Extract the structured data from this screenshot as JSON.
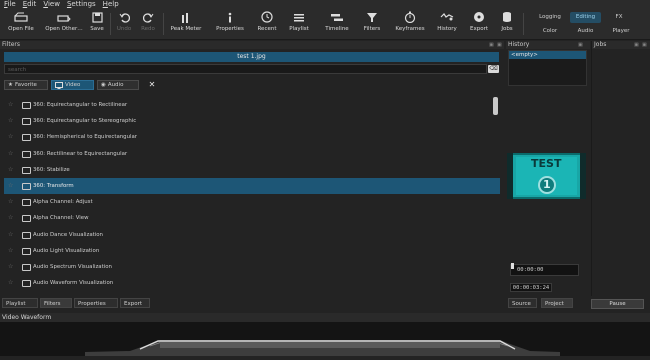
{
  "menu": [
    "File",
    "Edit",
    "View",
    "Settings",
    "Help"
  ],
  "toolbar": {
    "buttons": [
      {
        "label": "Open File",
        "icon": "open-file-icon"
      },
      {
        "label": "Open Other…",
        "icon": "open-other-icon"
      },
      {
        "label": "Save",
        "icon": "save-icon"
      },
      {
        "label": "Undo",
        "icon": "undo-icon"
      },
      {
        "label": "Redo",
        "icon": "redo-icon"
      },
      {
        "label": "Peak Meter",
        "icon": "peak-meter-icon"
      },
      {
        "label": "Properties",
        "icon": "info-icon"
      },
      {
        "label": "Recent",
        "icon": "clock-icon"
      },
      {
        "label": "Playlist",
        "icon": "playlist-icon"
      },
      {
        "label": "Timeline",
        "icon": "timeline-icon"
      },
      {
        "label": "Filters",
        "icon": "funnel-icon"
      },
      {
        "label": "Keyframes",
        "icon": "stopwatch-icon"
      },
      {
        "label": "History",
        "icon": "history-icon"
      },
      {
        "label": "Export",
        "icon": "export-icon"
      },
      {
        "label": "Jobs",
        "icon": "jobs-icon"
      }
    ],
    "layouts": {
      "logging": "Logging",
      "editing": "Editing",
      "fx": "FX",
      "color": "Color",
      "audio": "Audio",
      "player": "Player"
    }
  },
  "filters": {
    "title": "Filters",
    "current_file": "test 1.jpg",
    "search_placeholder": "search",
    "tabs": {
      "favorite": "Favorite",
      "video": "Video",
      "audio": "Audio"
    },
    "items": [
      "360: Equirectangular to Rectilinear",
      "360: Equirectangular to Stereographic",
      "360: Hemispherical to Equirectangular",
      "360: Rectilinear to Equirectangular",
      "360: Stabilize",
      "360: Transform",
      "Alpha Channel: Adjust",
      "Alpha Channel: View",
      "Audio Dance Visualization",
      "Audio Light Visualization",
      "Audio Spectrum Visualization",
      "Audio Waveform Visualization"
    ],
    "selected_index": 5
  },
  "bottom_tabs": [
    "Playlist",
    "Filters",
    "Properties",
    "Export"
  ],
  "history": {
    "title": "History",
    "items": [
      "<empty>"
    ]
  },
  "jobs": {
    "title": "Jobs",
    "pause_label": "Pause"
  },
  "player": {
    "timecode_position": "00:00:00",
    "timecode_duration": "00:00:03:24",
    "preview_text_top": "TEST",
    "preview_text_number": "1"
  },
  "source_tabs": {
    "source": "Source",
    "project": "Project"
  },
  "waveform": {
    "title": "Video Waveform"
  },
  "colors": {
    "accent": "#1d5676",
    "background": "#232323",
    "preview_bg": "#0d7878"
  }
}
